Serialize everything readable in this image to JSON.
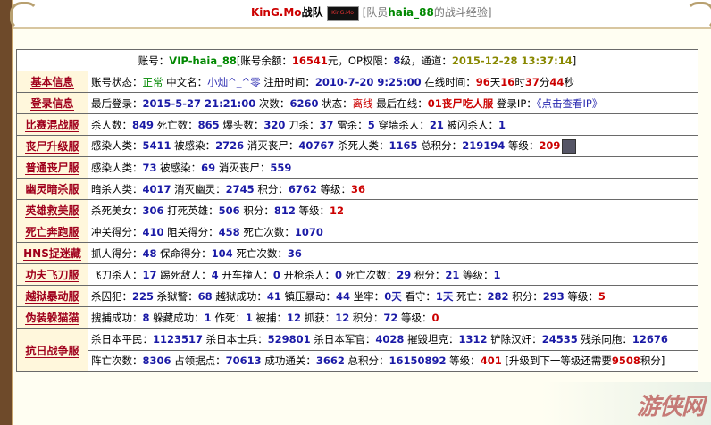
{
  "title": {
    "team_name": "KinG.Mo",
    "team_suffix": "战队",
    "logo_text": "KinG.Mo",
    "member_prefix": "[队员",
    "member_name": "haia_88",
    "member_suffix": "的战斗经验]"
  },
  "account": {
    "label": "账号：",
    "id": "VIP-haia_88",
    "balance_label": "[账号余额：",
    "balance": "16541",
    "balance_unit": "元，OP权限：",
    "op": "8",
    "op_unit": "级，通道：",
    "datetime": "2015-12-28 13:37:14",
    "end": "]"
  },
  "rows": {
    "basic": {
      "label": "基本信息",
      "status_label": "账号状态：",
      "status": "正常",
      "cn_label": " 中文名：",
      "cn_name": "小灿^_^零",
      "reg_label": " 注册时间：",
      "reg_time": "2010-7-20 9:25:00",
      "online_label": " 在线时间：",
      "days": "96",
      "days_unit": "天",
      "hours": "16",
      "hours_unit": "时",
      "mins": "37",
      "mins_unit": "分",
      "secs": "44",
      "secs_unit": "秒"
    },
    "login": {
      "label": "登录信息",
      "last_label": "最后登录：",
      "last_time": "2015-5-27 21:21:00",
      "count_label": " 次数：",
      "count": "6260",
      "state_label": " 状态：",
      "state": "离线",
      "last_online_label": " 最后在线：",
      "last_online": "01丧尸吃人服",
      "ip_label": " 登录IP：",
      "ip_link": "《点击查看IP》"
    },
    "mixed": {
      "label": "比赛混战服",
      "a_l": "杀人数：",
      "a": "849",
      "b_l": " 死亡数：",
      "b": "865",
      "c_l": " 爆头数：",
      "c": "320",
      "d_l": " 刀杀：",
      "d": "37",
      "e_l": " 雷杀：",
      "e": "5",
      "f_l": " 穿墙杀人：",
      "f": "21",
      "g_l": " 被闪杀人：",
      "g": "1"
    },
    "zombie_up": {
      "label": "丧尸升级服",
      "a_l": "感染人类：",
      "a": "5411",
      "b_l": " 被感染：",
      "b": "2726",
      "c_l": " 消灭丧尸：",
      "c": "40767",
      "d_l": " 杀死人类：",
      "d": "1165",
      "e_l": " 总积分：",
      "e": "219194",
      "f_l": " 等级：",
      "f": "209"
    },
    "zombie_norm": {
      "label": "普通丧尸服",
      "a_l": "感染人类：",
      "a": "73",
      "b_l": " 被感染：",
      "b": "69",
      "c_l": " 消灭丧尸：",
      "c": "559"
    },
    "ghost": {
      "label": "幽灵暗杀服",
      "a_l": "暗杀人类：",
      "a": "4017",
      "b_l": " 消灭幽灵：",
      "b": "2745",
      "c_l": " 积分：",
      "c": "6762",
      "d_l": " 等级：",
      "d": "36"
    },
    "hero": {
      "label": "英雄救美服",
      "a_l": "杀死美女：",
      "a": "306",
      "b_l": " 打死英雄：",
      "b": "506",
      "c_l": " 积分：",
      "c": "812",
      "d_l": " 等级：",
      "d": "12"
    },
    "death_run": {
      "label": "死亡奔跑服",
      "a_l": "冲关得分：",
      "a": "410",
      "b_l": " 阻关得分：",
      "b": "458",
      "c_l": " 死亡次数：",
      "c": "1070"
    },
    "hns": {
      "label": "HNS捉迷藏",
      "a_l": "抓人得分：",
      "a": "48",
      "b_l": " 保命得分：",
      "b": "104",
      "c_l": " 死亡次数：",
      "c": "36"
    },
    "kungfu": {
      "label": "功夫飞刀服",
      "a_l": "飞刀杀人：",
      "a": "17",
      "b_l": " 踢死敌人：",
      "b": "4",
      "c_l": " 开车撞人：",
      "c": "0",
      "d_l": " 开枪杀人：",
      "d": "0",
      "e_l": " 死亡次数：",
      "e": "29",
      "f_l": " 积分：",
      "f": "21",
      "g_l": " 等级：",
      "g": "1"
    },
    "jail": {
      "label": "越狱暴动服",
      "a_l": "杀囚犯：",
      "a": "225",
      "b_l": " 杀狱警：",
      "b": "68",
      "c_l": " 越狱成功：",
      "c": "41",
      "d_l": " 镇压暴动：",
      "d": "44",
      "e_l": " 坐牢：",
      "e": "0",
      "e_u": "天",
      "f_l": " 看守：",
      "f": "1",
      "f_u": "天",
      "g_l": " 死亡：",
      "g": "282",
      "h_l": " 积分：",
      "h": "293",
      "i_l": " 等级：",
      "i": "5"
    },
    "disguise": {
      "label": "伪装躲猫猫",
      "a_l": "搜捕成功：",
      "a": "8",
      "b_l": " 躲藏成功：",
      "b": "1",
      "c_l": " 作死：",
      "c": "1",
      "d_l": " 被捕：",
      "d": "12",
      "e_l": " 抓获：",
      "e": "12",
      "f_l": " 积分：",
      "f": "72",
      "g_l": " 等级：",
      "g": "0"
    },
    "antijapan": {
      "label": "抗日战争服",
      "a_l": "杀日本平民：",
      "a": "1123517",
      "b_l": " 杀日本士兵：",
      "b": "529801",
      "c_l": " 杀日本军官：",
      "c": "4028",
      "d_l": " 摧毁坦克：",
      "d": "1312",
      "e_l": " 铲除汉奸：",
      "e": "24535",
      "f_l": " 残杀同胞：",
      "f": "12676",
      "g_l": "阵亡次数：",
      "g": "8306",
      "h_l": " 占领据点：",
      "h": "70613",
      "i_l": " 成功通关：",
      "i": "3662",
      "j_l": " 总积分：",
      "j": "16150892",
      "k_l": " 等级：",
      "k": "401",
      "up_pre": " [升级到下一等级还需要",
      "up": "9508",
      "up_post": "积分]"
    }
  },
  "watermark": "游侠网"
}
